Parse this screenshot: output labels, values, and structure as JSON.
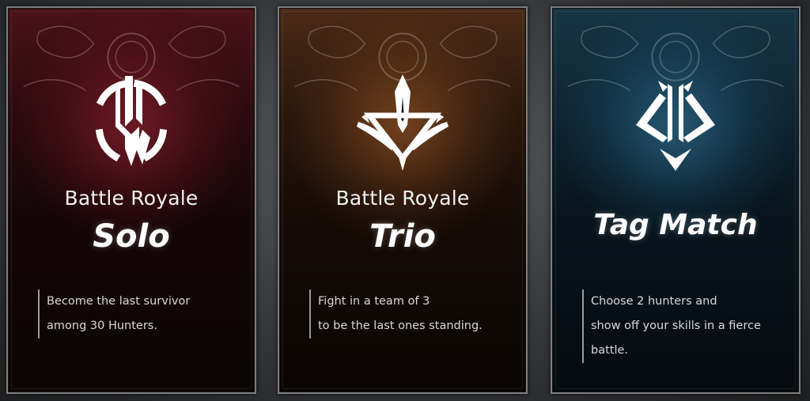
{
  "cards": [
    {
      "id": "solo",
      "subtitle": "Battle Royale",
      "mode": "Solo",
      "description": [
        "Become the last survivor",
        "among 30 Hunters."
      ],
      "accent": "#8a1f2c",
      "icon": "solo-emblem-icon"
    },
    {
      "id": "trio",
      "subtitle": "Battle Royale",
      "mode": "Trio",
      "description": [
        "Fight in a team of 3",
        "to be the last ones standing."
      ],
      "accent": "#a0602c",
      "icon": "trio-emblem-icon"
    },
    {
      "id": "tag",
      "subtitle": "",
      "mode": "Tag Match",
      "description": [
        "Choose 2 hunters and",
        "show off your skills in a fierce",
        "battle."
      ],
      "accent": "#2f7ea4",
      "icon": "tag-match-emblem-icon"
    }
  ]
}
